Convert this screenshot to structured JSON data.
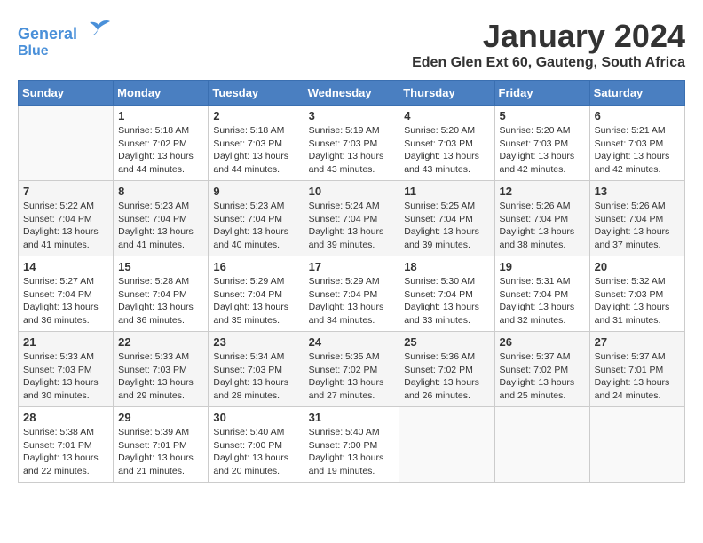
{
  "header": {
    "logo_line1": "General",
    "logo_line2": "Blue",
    "month_title": "January 2024",
    "location": "Eden Glen Ext 60, Gauteng, South Africa"
  },
  "columns": [
    "Sunday",
    "Monday",
    "Tuesday",
    "Wednesday",
    "Thursday",
    "Friday",
    "Saturday"
  ],
  "weeks": [
    [
      {
        "date": "",
        "info": ""
      },
      {
        "date": "1",
        "info": "Sunrise: 5:18 AM\nSunset: 7:02 PM\nDaylight: 13 hours\nand 44 minutes."
      },
      {
        "date": "2",
        "info": "Sunrise: 5:18 AM\nSunset: 7:03 PM\nDaylight: 13 hours\nand 44 minutes."
      },
      {
        "date": "3",
        "info": "Sunrise: 5:19 AM\nSunset: 7:03 PM\nDaylight: 13 hours\nand 43 minutes."
      },
      {
        "date": "4",
        "info": "Sunrise: 5:20 AM\nSunset: 7:03 PM\nDaylight: 13 hours\nand 43 minutes."
      },
      {
        "date": "5",
        "info": "Sunrise: 5:20 AM\nSunset: 7:03 PM\nDaylight: 13 hours\nand 42 minutes."
      },
      {
        "date": "6",
        "info": "Sunrise: 5:21 AM\nSunset: 7:03 PM\nDaylight: 13 hours\nand 42 minutes."
      }
    ],
    [
      {
        "date": "7",
        "info": "Sunrise: 5:22 AM\nSunset: 7:04 PM\nDaylight: 13 hours\nand 41 minutes."
      },
      {
        "date": "8",
        "info": "Sunrise: 5:23 AM\nSunset: 7:04 PM\nDaylight: 13 hours\nand 41 minutes."
      },
      {
        "date": "9",
        "info": "Sunrise: 5:23 AM\nSunset: 7:04 PM\nDaylight: 13 hours\nand 40 minutes."
      },
      {
        "date": "10",
        "info": "Sunrise: 5:24 AM\nSunset: 7:04 PM\nDaylight: 13 hours\nand 39 minutes."
      },
      {
        "date": "11",
        "info": "Sunrise: 5:25 AM\nSunset: 7:04 PM\nDaylight: 13 hours\nand 39 minutes."
      },
      {
        "date": "12",
        "info": "Sunrise: 5:26 AM\nSunset: 7:04 PM\nDaylight: 13 hours\nand 38 minutes."
      },
      {
        "date": "13",
        "info": "Sunrise: 5:26 AM\nSunset: 7:04 PM\nDaylight: 13 hours\nand 37 minutes."
      }
    ],
    [
      {
        "date": "14",
        "info": "Sunrise: 5:27 AM\nSunset: 7:04 PM\nDaylight: 13 hours\nand 36 minutes."
      },
      {
        "date": "15",
        "info": "Sunrise: 5:28 AM\nSunset: 7:04 PM\nDaylight: 13 hours\nand 36 minutes."
      },
      {
        "date": "16",
        "info": "Sunrise: 5:29 AM\nSunset: 7:04 PM\nDaylight: 13 hours\nand 35 minutes."
      },
      {
        "date": "17",
        "info": "Sunrise: 5:29 AM\nSunset: 7:04 PM\nDaylight: 13 hours\nand 34 minutes."
      },
      {
        "date": "18",
        "info": "Sunrise: 5:30 AM\nSunset: 7:04 PM\nDaylight: 13 hours\nand 33 minutes."
      },
      {
        "date": "19",
        "info": "Sunrise: 5:31 AM\nSunset: 7:04 PM\nDaylight: 13 hours\nand 32 minutes."
      },
      {
        "date": "20",
        "info": "Sunrise: 5:32 AM\nSunset: 7:03 PM\nDaylight: 13 hours\nand 31 minutes."
      }
    ],
    [
      {
        "date": "21",
        "info": "Sunrise: 5:33 AM\nSunset: 7:03 PM\nDaylight: 13 hours\nand 30 minutes."
      },
      {
        "date": "22",
        "info": "Sunrise: 5:33 AM\nSunset: 7:03 PM\nDaylight: 13 hours\nand 29 minutes."
      },
      {
        "date": "23",
        "info": "Sunrise: 5:34 AM\nSunset: 7:03 PM\nDaylight: 13 hours\nand 28 minutes."
      },
      {
        "date": "24",
        "info": "Sunrise: 5:35 AM\nSunset: 7:02 PM\nDaylight: 13 hours\nand 27 minutes."
      },
      {
        "date": "25",
        "info": "Sunrise: 5:36 AM\nSunset: 7:02 PM\nDaylight: 13 hours\nand 26 minutes."
      },
      {
        "date": "26",
        "info": "Sunrise: 5:37 AM\nSunset: 7:02 PM\nDaylight: 13 hours\nand 25 minutes."
      },
      {
        "date": "27",
        "info": "Sunrise: 5:37 AM\nSunset: 7:01 PM\nDaylight: 13 hours\nand 24 minutes."
      }
    ],
    [
      {
        "date": "28",
        "info": "Sunrise: 5:38 AM\nSunset: 7:01 PM\nDaylight: 13 hours\nand 22 minutes."
      },
      {
        "date": "29",
        "info": "Sunrise: 5:39 AM\nSunset: 7:01 PM\nDaylight: 13 hours\nand 21 minutes."
      },
      {
        "date": "30",
        "info": "Sunrise: 5:40 AM\nSunset: 7:00 PM\nDaylight: 13 hours\nand 20 minutes."
      },
      {
        "date": "31",
        "info": "Sunrise: 5:40 AM\nSunset: 7:00 PM\nDaylight: 13 hours\nand 19 minutes."
      },
      {
        "date": "",
        "info": ""
      },
      {
        "date": "",
        "info": ""
      },
      {
        "date": "",
        "info": ""
      }
    ]
  ]
}
